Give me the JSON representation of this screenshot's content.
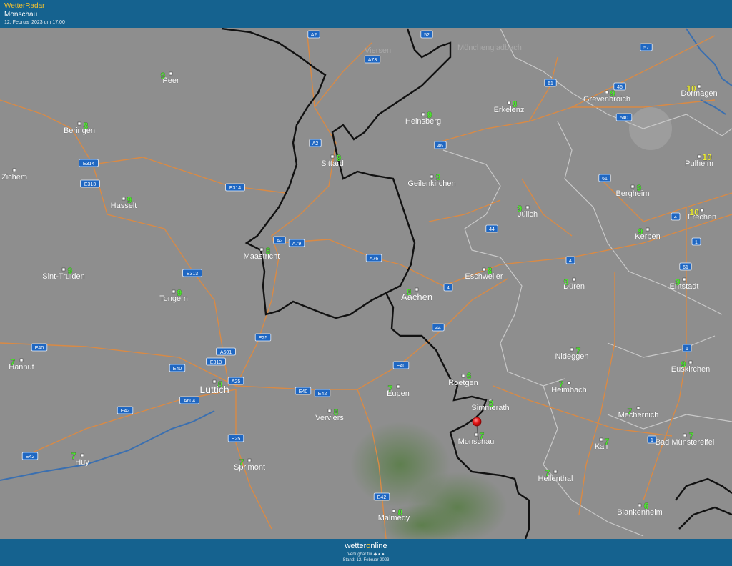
{
  "header": {
    "brand": "WetterRadar",
    "location": "Monschau",
    "timestamp": "12. Februar 2023 um 17:00"
  },
  "footer": {
    "logo_main": "wetter",
    "logo_o": "o",
    "logo_tail": "nline",
    "available": "Verfügbar für",
    "stand": "Stand: 12. Februar 2023"
  },
  "colors": {
    "header_bg": "#15628f",
    "brand": "#f2c230",
    "temp_green": "#4ee62f",
    "temp_yellow": "#eded3a",
    "road": "#d98a45",
    "border": "#111111",
    "river": "#3a6fb0",
    "pin": "#e31414"
  },
  "map": {
    "marker": {
      "name": "map-pin-icon",
      "place": "Monschau"
    },
    "ghost_labels": [
      {
        "id": "ghost-1",
        "text": "Viersen"
      },
      {
        "id": "ghost-2",
        "text": "Mönchengladbach"
      }
    ],
    "cities": [
      {
        "id": "peer",
        "name": "Peer",
        "temp": "9"
      },
      {
        "id": "beringen",
        "name": "Beringen",
        "temp": "8"
      },
      {
        "id": "zichem",
        "name": "Zichem",
        "temp": ""
      },
      {
        "id": "hasselt",
        "name": "Hasselt",
        "temp": "9"
      },
      {
        "id": "sint-truiden",
        "name": "Sint-Truiden",
        "temp": "9"
      },
      {
        "id": "tongern",
        "name": "Tongern",
        "temp": "9"
      },
      {
        "id": "hannut",
        "name": "Hannut",
        "temp": "7"
      },
      {
        "id": "luettich",
        "name": "Lüttich",
        "temp": "8"
      },
      {
        "id": "huy",
        "name": "Huy",
        "temp": "7"
      },
      {
        "id": "sprimont",
        "name": "Sprimont",
        "temp": "7"
      },
      {
        "id": "verviers",
        "name": "Verviers",
        "temp": "8"
      },
      {
        "id": "eupen",
        "name": "Eupen",
        "temp": "7"
      },
      {
        "id": "malmedy",
        "name": "Malmedy",
        "temp": "8"
      },
      {
        "id": "maastricht",
        "name": "Maastricht",
        "temp": "8"
      },
      {
        "id": "sittard",
        "name": "Sittard",
        "temp": "9"
      },
      {
        "id": "heinsberg",
        "name": "Heinsberg",
        "temp": "9"
      },
      {
        "id": "geilenkirchen",
        "name": "Geilenkirchen",
        "temp": "9"
      },
      {
        "id": "erkelenz",
        "name": "Erkelenz",
        "temp": "8"
      },
      {
        "id": "aachen",
        "name": "Aachen",
        "temp": "8"
      },
      {
        "id": "eschweiler",
        "name": "Eschweiler",
        "temp": "8"
      },
      {
        "id": "juelich",
        "name": "Jülich",
        "temp": "9"
      },
      {
        "id": "roetgen",
        "name": "Roetgen",
        "temp": "6"
      },
      {
        "id": "simmerath",
        "name": "Simmerath",
        "temp": "8"
      },
      {
        "id": "monschau",
        "name": "Monschau",
        "temp": "7"
      },
      {
        "id": "grevenbroich",
        "name": "Grevenbroich",
        "temp": "9"
      },
      {
        "id": "dormagen",
        "name": "Dormagen",
        "temp": "10"
      },
      {
        "id": "pulheim",
        "name": "Pulheim",
        "temp": "10"
      },
      {
        "id": "bergheim",
        "name": "Bergheim",
        "temp": "9"
      },
      {
        "id": "frechen",
        "name": "Frechen",
        "temp": "10"
      },
      {
        "id": "kerpen",
        "name": "Kerpen",
        "temp": "9"
      },
      {
        "id": "dueren",
        "name": "Düren",
        "temp": "9"
      },
      {
        "id": "erftstadt",
        "name": "Erftstadt",
        "temp": "9"
      },
      {
        "id": "nideggen",
        "name": "Nideggen",
        "temp": "7"
      },
      {
        "id": "euskirchen",
        "name": "Euskirchen",
        "temp": "9"
      },
      {
        "id": "heimbach",
        "name": "Heimbach",
        "temp": "7"
      },
      {
        "id": "mechernich",
        "name": "Mechernich",
        "temp": "7"
      },
      {
        "id": "kall",
        "name": "Kall",
        "temp": "7"
      },
      {
        "id": "bad-muenstereifel",
        "name": "Bad Münstereifel",
        "temp": "7"
      },
      {
        "id": "hellenthal",
        "name": "Hellenthal",
        "temp": "7"
      },
      {
        "id": "blankenheim",
        "name": "Blankenheim",
        "temp": "6"
      }
    ],
    "road_shields": [
      {
        "id": "a2-north",
        "text": "A2"
      },
      {
        "id": "a73",
        "text": "A73"
      },
      {
        "id": "52",
        "text": "52"
      },
      {
        "id": "57",
        "text": "57"
      },
      {
        "id": "61-a",
        "text": "61"
      },
      {
        "id": "46-a",
        "text": "46"
      },
      {
        "id": "540",
        "text": "540"
      },
      {
        "id": "a2-mid",
        "text": "A2"
      },
      {
        "id": "46-b",
        "text": "46"
      },
      {
        "id": "e314-a",
        "text": "E314"
      },
      {
        "id": "e313-a",
        "text": "E313"
      },
      {
        "id": "e314-b",
        "text": "E314"
      },
      {
        "id": "61-b",
        "text": "61"
      },
      {
        "id": "4-a",
        "text": "4"
      },
      {
        "id": "a2-south",
        "text": "A2"
      },
      {
        "id": "a79",
        "text": "A79"
      },
      {
        "id": "44-a",
        "text": "44"
      },
      {
        "id": "1-a",
        "text": "1"
      },
      {
        "id": "a76",
        "text": "A76"
      },
      {
        "id": "4-b",
        "text": "4"
      },
      {
        "id": "61-c",
        "text": "61"
      },
      {
        "id": "e313-b",
        "text": "E313"
      },
      {
        "id": "4-c",
        "text": "4"
      },
      {
        "id": "e25-a",
        "text": "E25"
      },
      {
        "id": "44-b",
        "text": "44"
      },
      {
        "id": "e40-a",
        "text": "E40"
      },
      {
        "id": "a601",
        "text": "A601"
      },
      {
        "id": "1-b",
        "text": "1"
      },
      {
        "id": "e40-b",
        "text": "E40"
      },
      {
        "id": "e313-c",
        "text": "E313"
      },
      {
        "id": "e40-c",
        "text": "E40"
      },
      {
        "id": "a25",
        "text": "A25"
      },
      {
        "id": "e40-d",
        "text": "E40"
      },
      {
        "id": "e42-a",
        "text": "E42"
      },
      {
        "id": "a604",
        "text": "A604"
      },
      {
        "id": "e42-b",
        "text": "E42"
      },
      {
        "id": "e25-b",
        "text": "E25"
      },
      {
        "id": "1-c",
        "text": "1"
      },
      {
        "id": "e42-c",
        "text": "E42"
      },
      {
        "id": "e42-d",
        "text": "E42"
      }
    ]
  }
}
